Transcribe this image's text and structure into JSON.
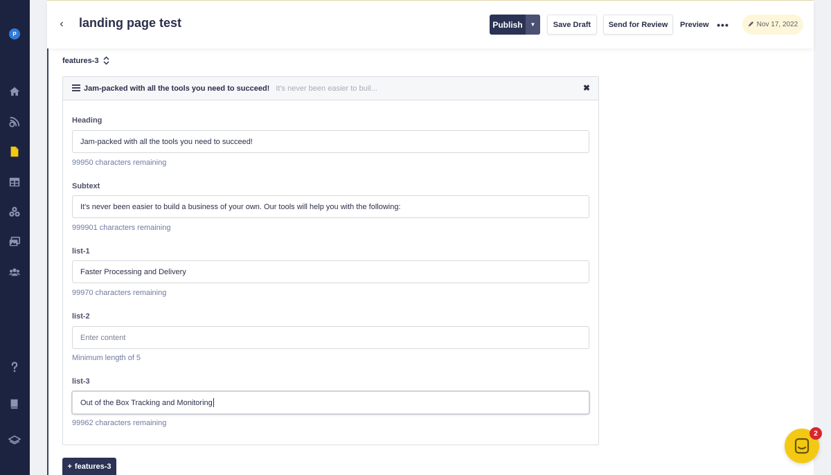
{
  "app": {
    "logo_letter": "P"
  },
  "sidebar": {
    "icons": [
      "home-icon",
      "blog-icon",
      "pages-icon",
      "layout-icon",
      "integrations-icon",
      "media-icon",
      "users-icon",
      "help-icon",
      "docs-icon",
      "layers-icon"
    ]
  },
  "header": {
    "back_label": "‹",
    "title": "landing page test",
    "publish_label": "Publish",
    "save_draft_label": "Save Draft",
    "send_review_label": "Send for Review",
    "preview_label": "Preview",
    "more_label": "•••",
    "date_label": "Nov 17, 2022"
  },
  "section": {
    "selector_label": "features-3",
    "panel_title": "Jam-packed with all the tools you need to succeed!",
    "panel_subtitle": "It's never been easier to buil...",
    "close_label": "✖"
  },
  "fields": [
    {
      "label": "Heading",
      "value": "Jam-packed with all the tools you need to succeed!",
      "help": "99950 characters remaining"
    },
    {
      "label": "Subtext",
      "value": "It's never been easier to build a business of your own. Our tools will help you with the following:",
      "help": "999901 characters remaining"
    },
    {
      "label": "list-1",
      "value": "Faster Processing and Delivery",
      "help": "99970 characters remaining"
    },
    {
      "label": "list-2",
      "placeholder": "Enter content",
      "help": "Minimum length of 5"
    },
    {
      "label": "list-3",
      "value": "Out of the Box Tracking and Monitoring",
      "help": "99962 characters remaining"
    }
  ],
  "add_button_label": "features-3",
  "chat": {
    "badge_count": "2"
  },
  "colors": {
    "sidebar_bg": "#1c2340",
    "primary_button": "#2b3253",
    "date_badge_bg": "#fdf6d8",
    "help_text": "#6f7aa0",
    "chat_bg": "#f3c913",
    "badge_red": "#d9262f"
  }
}
